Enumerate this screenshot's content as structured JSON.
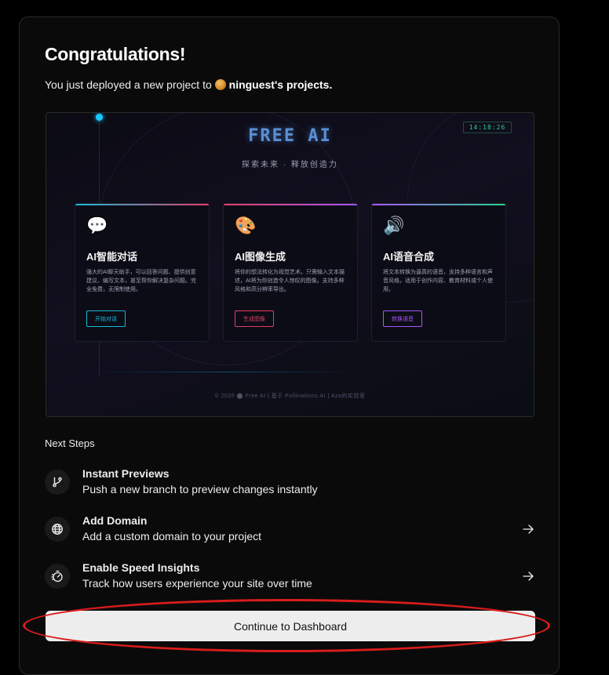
{
  "header": {
    "title": "Congratulations!",
    "subtitle_prefix": "You just deployed a new project to",
    "owner": "ninguest's projects."
  },
  "preview": {
    "brand": "FREE AI",
    "tagline": "探索未来 · 释放创造力",
    "clock": "14:18:26",
    "features": [
      {
        "icon": "💬",
        "name": "AI智能对话",
        "desc": "强大的AI聊天助手，可以回答问题、提供创意建议、编写文本，甚至帮你解决复杂问题。完全免费，无限制使用。",
        "button": "开始对话",
        "color": "#19b7d8"
      },
      {
        "icon": "🎨",
        "name": "AI图像生成",
        "desc": "将你的想法转化为视觉艺术。只需输入文本描述，AI将为你创造令人惊叹的图像。支持多种风格和高分辨率导出。",
        "button": "生成图像",
        "color": "#e23f66"
      },
      {
        "icon": "🔊",
        "name": "AI语音合成",
        "desc": "将文本转换为逼真的语音，支持多种语言和声音风格，适用于创作内容、教育材料或个人使用。",
        "button": "转换语音",
        "color": "#a855f7"
      }
    ],
    "footer": "© 2025 ⬤ Free AI | 基于 Pollinations.AI | Aza的实验室"
  },
  "next_steps": {
    "heading": "Next Steps",
    "items": [
      {
        "icon": "git-branch-icon",
        "title": "Instant Previews",
        "desc": "Push a new branch to preview changes instantly",
        "has_arrow": false
      },
      {
        "icon": "globe-icon",
        "title": "Add Domain",
        "desc": "Add a custom domain to your project",
        "has_arrow": true
      },
      {
        "icon": "speed-gauge-icon",
        "title": "Enable Speed Insights",
        "desc": "Track how users experience your site over time",
        "has_arrow": true
      }
    ]
  },
  "continue_label": "Continue to Dashboard",
  "colors": {
    "background": "#000000",
    "card": "#0a0a0a",
    "button": "#ededed",
    "highlight": "#d91c1c",
    "preview_green": "#25d28a"
  }
}
